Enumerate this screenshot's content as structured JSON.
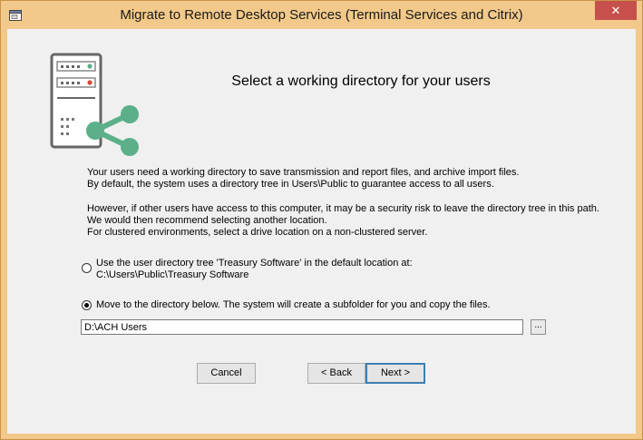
{
  "window": {
    "title": "Migrate to Remote Desktop Services (Terminal Services and Citrix)",
    "close_glyph": "✕"
  },
  "heading": "Select a working directory for your users",
  "paragraphs": {
    "intro": [
      "Your users need a working directory to save transmission and report files, and archive import files.",
      "By default, the system uses a directory tree in Users\\Public to guarantee access to all users."
    ],
    "warning": [
      "However, if other users have access to this computer, it may be a security risk to leave the directory tree in this path.",
      "We would then recommend selecting another location.",
      "For clustered environments, select a drive location on a non-clustered server."
    ]
  },
  "options": {
    "default_location": {
      "checked": false,
      "line1": "Use the user directory tree 'Treasury Software' in the default location at:",
      "line2": "C:\\Users\\Public\\Treasury Software"
    },
    "custom_location": {
      "checked": true,
      "label": "Move to the directory below. The system will create a subfolder for you and copy the files."
    }
  },
  "path_field": {
    "value": "D:\\ACH Users"
  },
  "browse_label": "...",
  "buttons": {
    "cancel": "Cancel",
    "back": "< Back",
    "next": "Next >"
  },
  "colors": {
    "titlebar": "#f2c98a",
    "close_button": "#c7504c",
    "logo_green": "#5bb08a",
    "client_bg": "#f0f0f0"
  },
  "icons": {
    "app": "window-icon",
    "logo": "server-share-logo",
    "close": "close-icon"
  }
}
